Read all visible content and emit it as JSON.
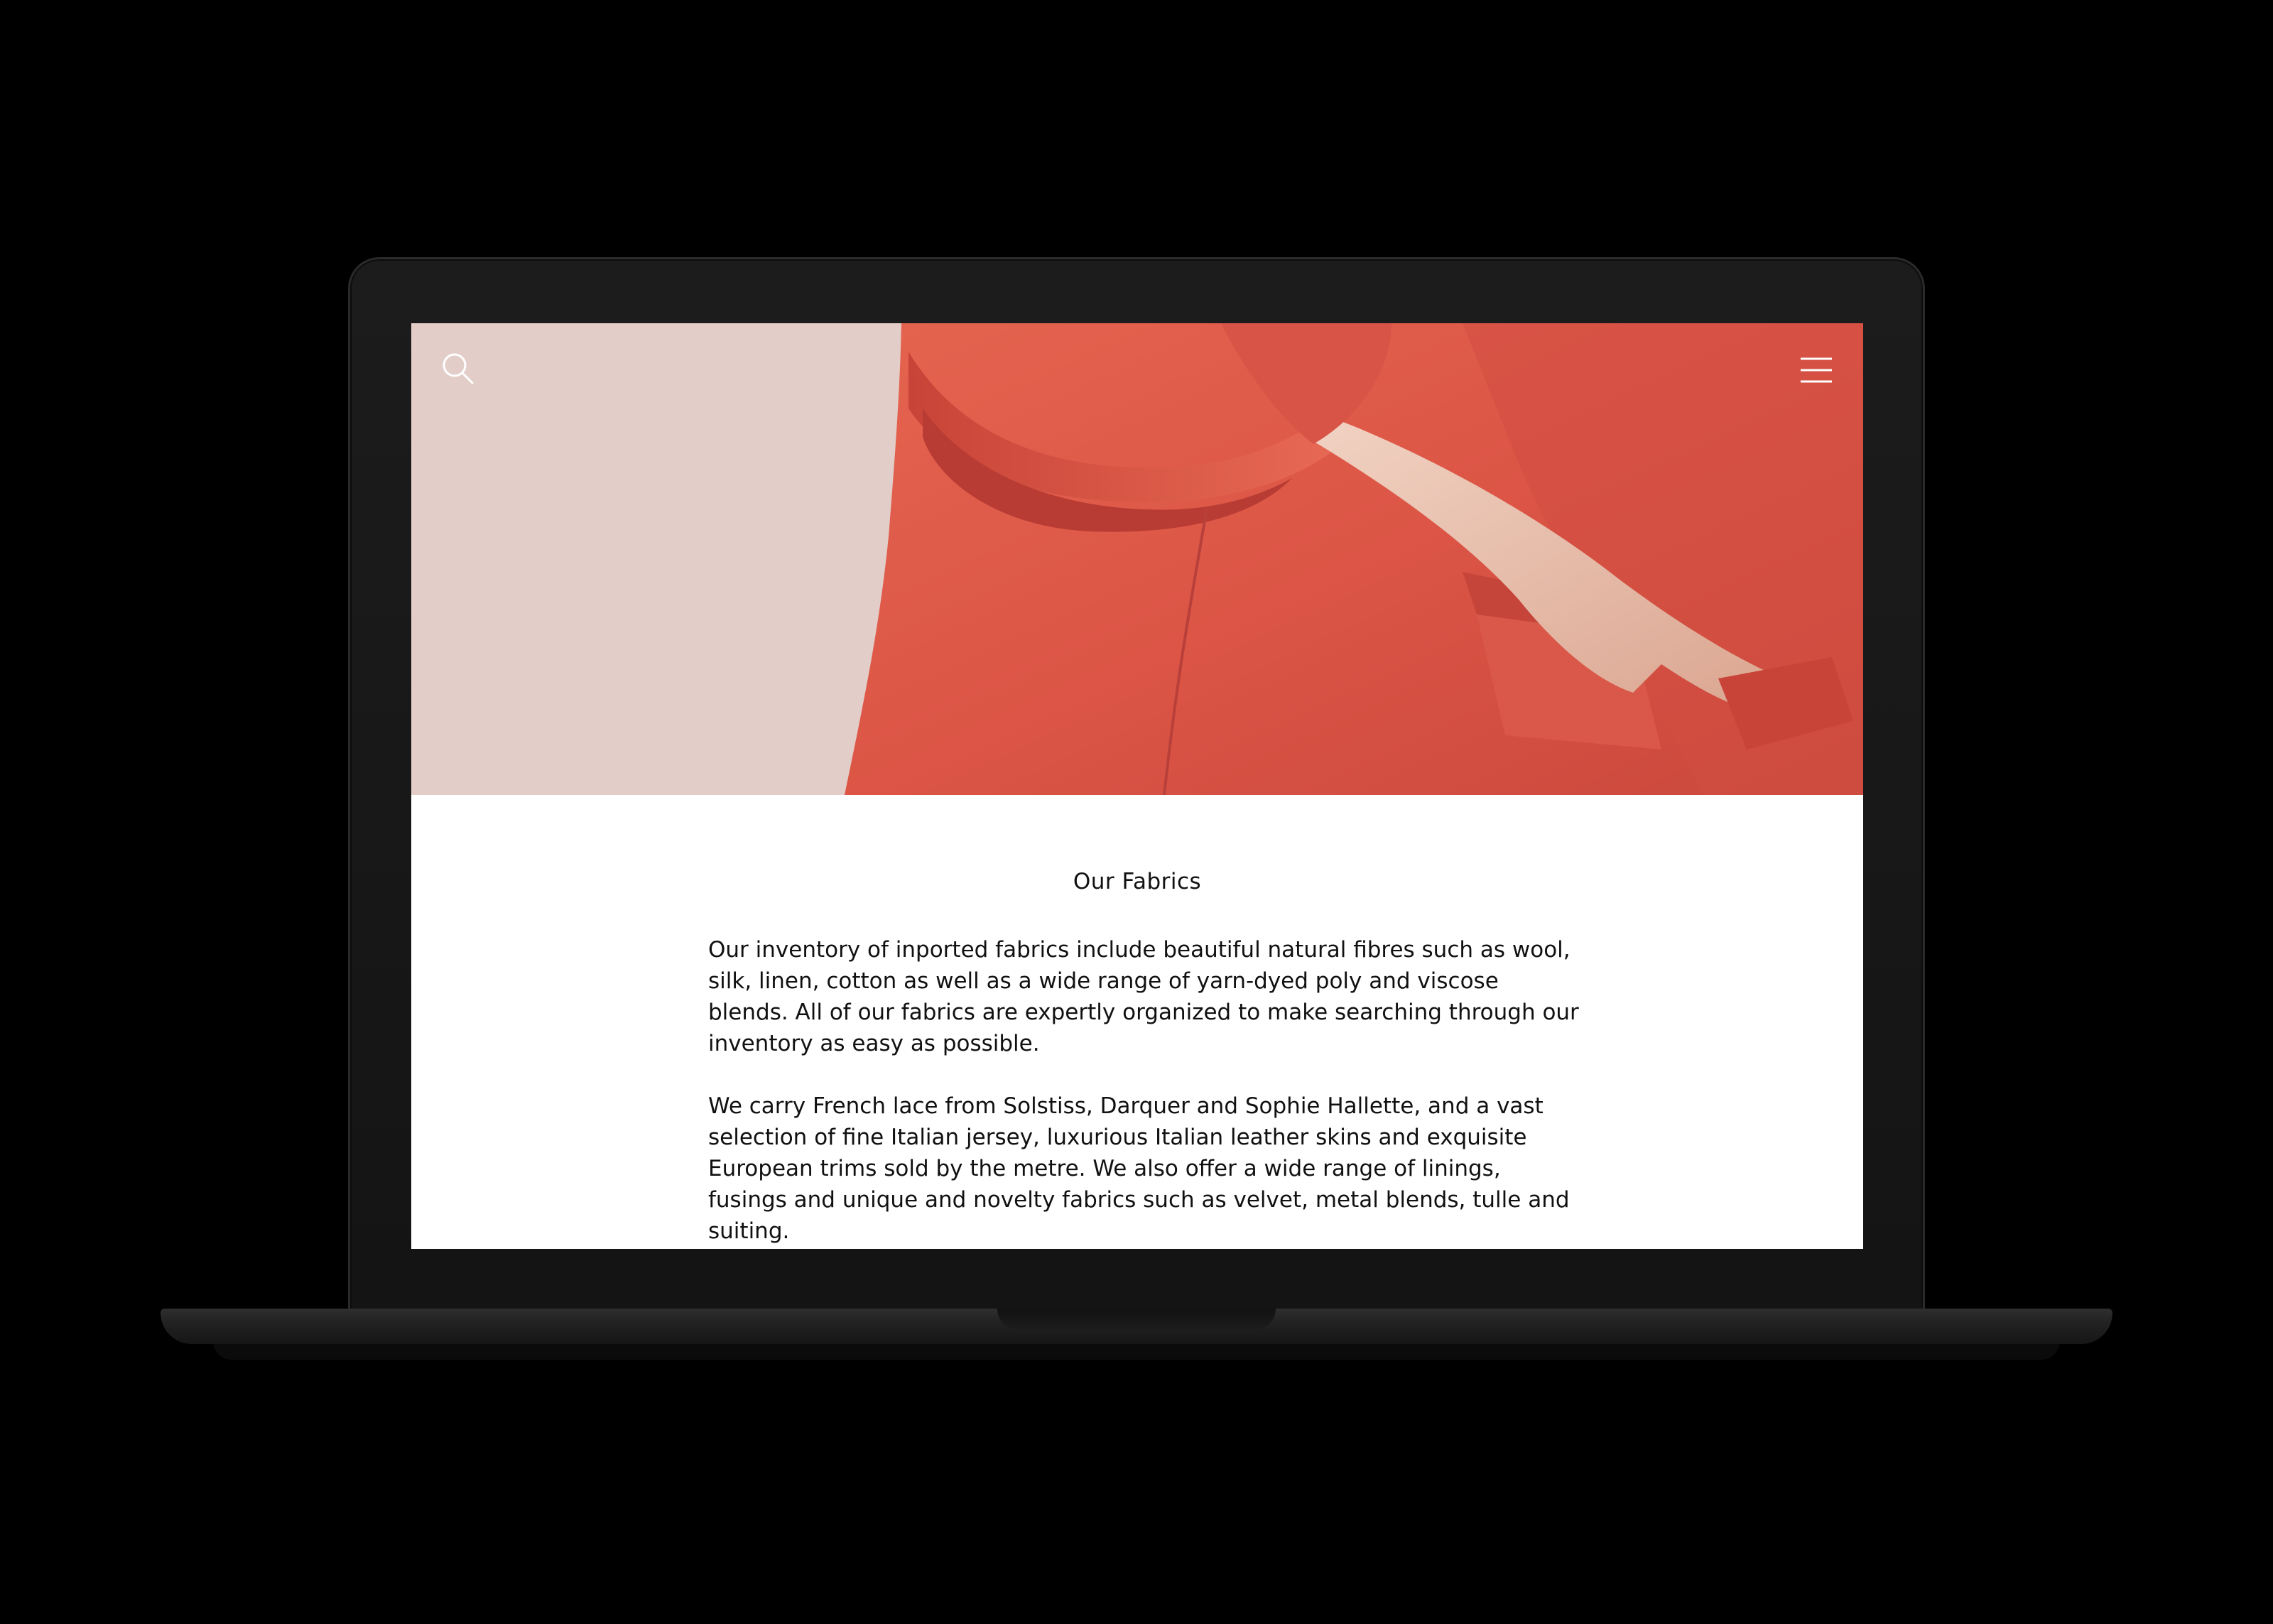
{
  "page": {
    "section_title": "Our Fabrics",
    "paragraphs": [
      "Our inventory of inported fabrics include beautiful natural fibres such as wool, silk, linen, cotton as well as a wide range of yarn-dyed poly and viscose blends. All of our fabrics are expertly organized to make searching through our inventory as easy as possible.",
      "We carry French lace from Solstiss, Darquer and Sophie Hallette, and a vast selection of fine Italian jersey, luxurious Italian leather skins and exquisite European trims sold by the metre. We also offer a wide range of linings, fusings and unique and novelty fabrics such as velvet, metal blends, tulle and suiting."
    ]
  },
  "nav": {
    "search_icon": "search-icon",
    "menu_icon": "hamburger-menu-icon"
  },
  "colors": {
    "hero_blush": "#e2cdc8",
    "coat_red": "#e0584a",
    "background": "#000000",
    "text": "#111111"
  }
}
